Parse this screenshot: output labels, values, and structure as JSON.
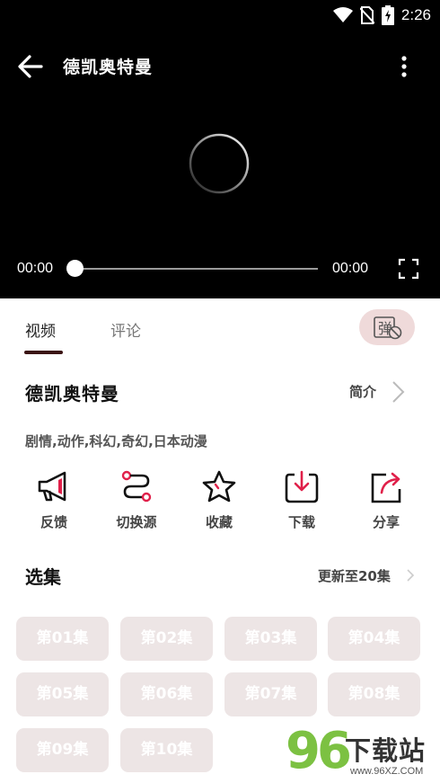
{
  "status_bar": {
    "time": "2:26",
    "icons": [
      "wifi-icon",
      "no-sim-icon",
      "battery-charging-icon"
    ]
  },
  "player": {
    "title": "德凯奥特曼",
    "current_time": "00:00",
    "total_time": "00:00",
    "progress": 0,
    "icons": [
      "back-arrow-icon",
      "more-vert-icon",
      "loading-spinner-icon",
      "fullscreen-icon"
    ]
  },
  "tabs": [
    {
      "label": "视频",
      "active": true
    },
    {
      "label": "评论",
      "active": false
    }
  ],
  "danmu_label": "弹",
  "info": {
    "title": "德凯奥特曼",
    "intro_label": "简介",
    "genres": "剧情,动作,科幻,奇幻,日本动漫"
  },
  "actions": [
    {
      "label": "反馈",
      "icon": "megaphone-icon"
    },
    {
      "label": "切换源",
      "icon": "route-icon"
    },
    {
      "label": "收藏",
      "icon": "star-icon"
    },
    {
      "label": "下载",
      "icon": "download-icon"
    },
    {
      "label": "分享",
      "icon": "share-icon"
    }
  ],
  "episodes": {
    "heading": "选集",
    "update_text": "更新至20集",
    "items": [
      "第01集",
      "第02集",
      "第03集",
      "第04集",
      "第05集",
      "第06集",
      "第07集",
      "第08集",
      "第09集",
      "第10集"
    ]
  },
  "watermark": {
    "number": "96",
    "text": "下载站",
    "url": "www.96XZ.COM"
  },
  "colors": {
    "accent": "#3b1414",
    "episode_bg": "#ede5e5",
    "danmu_bg": "#efdada",
    "player_bg": "#000000"
  }
}
